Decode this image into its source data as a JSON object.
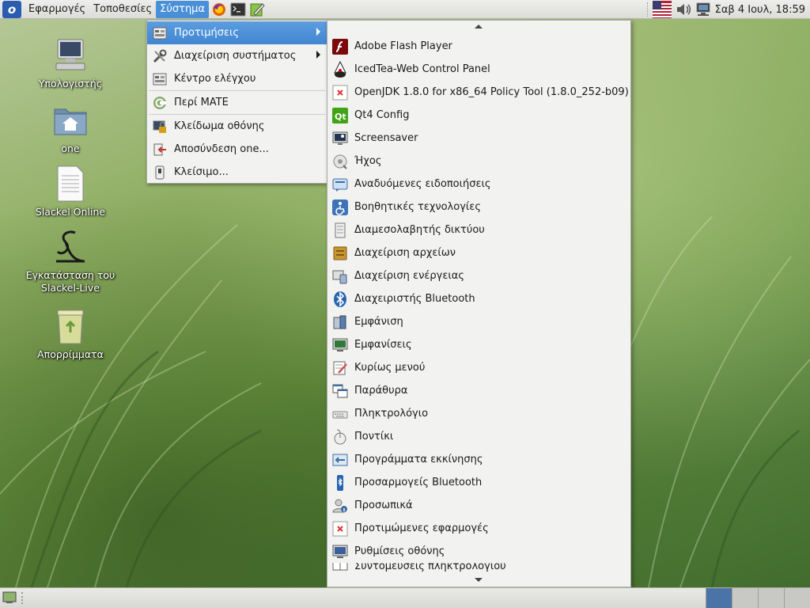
{
  "top_panel": {
    "menus": [
      "Εφαρμογές",
      "Τοποθεσίες",
      "Σύστημα"
    ],
    "active_menu": "Σύστημα",
    "launchers": [
      "firefox-icon",
      "terminal-icon",
      "text-editor-icon"
    ],
    "tray": {
      "keyboard_layout": "us-flag-icon",
      "volume": "volume-icon",
      "network": "network-icon",
      "clock": "Σαβ  4 Ιουλ, 18:59"
    }
  },
  "desktop_icons": [
    {
      "label": "Υπολογιστής",
      "icon": "computer-icon"
    },
    {
      "label": "one",
      "icon": "home-folder-icon"
    },
    {
      "label": "Slackel Online",
      "icon": "document-icon"
    },
    {
      "label": "Εγκατάσταση του Slackel-Live",
      "icon": "slackel-installer-icon"
    },
    {
      "label": "Απορρίμματα",
      "icon": "trash-icon"
    }
  ],
  "system_menu": {
    "items": [
      {
        "label": "Προτιμήσεις",
        "submenu": true,
        "highlighted": true
      },
      {
        "label": "Διαχείριση συστήματος",
        "submenu": true
      },
      {
        "label": "Κέντρο ελέγχου"
      },
      {
        "label": "Περί MATE"
      },
      {
        "label": "Κλείδωμα οθόνης"
      },
      {
        "label": "Αποσύνδεση one..."
      },
      {
        "label": "Κλείσιμο..."
      }
    ]
  },
  "preferences_menu": {
    "items": [
      "Adobe Flash Player",
      "IcedTea-Web Control Panel",
      "OpenJDK 1.8.0 for x86_64 Policy Tool (1.8.0_252-b09)",
      "Qt4 Config",
      "Screensaver",
      "Ήχος",
      "Αναδυόμενες ειδοποιήσεις",
      "Βοηθητικές τεχνολογίες",
      "Διαμεσολαβητής δικτύου",
      "Διαχείριση αρχείων",
      "Διαχείριση ενέργειας",
      "Διαχειριστής Bluetooth",
      "Εμφάνιση",
      "Εμφανίσεις",
      "Κυρίως μενού",
      "Παράθυρα",
      "Πληκτρολόγιο",
      "Ποντίκι",
      "Προγράμματα εκκίνησης",
      "Προσαρμογείς Bluetooth",
      "Προσωπικά",
      "Προτιμώμενες εφαρμογές",
      "Ρυθμίσεις οθόνης",
      "Συντομεύσεις πληκτρολογίου"
    ]
  },
  "bottom_panel": {
    "workspaces_count": 4,
    "active_workspace": 1
  },
  "colors": {
    "highlight": "#4a90d9",
    "panel": "#e4e4e1",
    "menu_bg": "#f2f2f1"
  }
}
